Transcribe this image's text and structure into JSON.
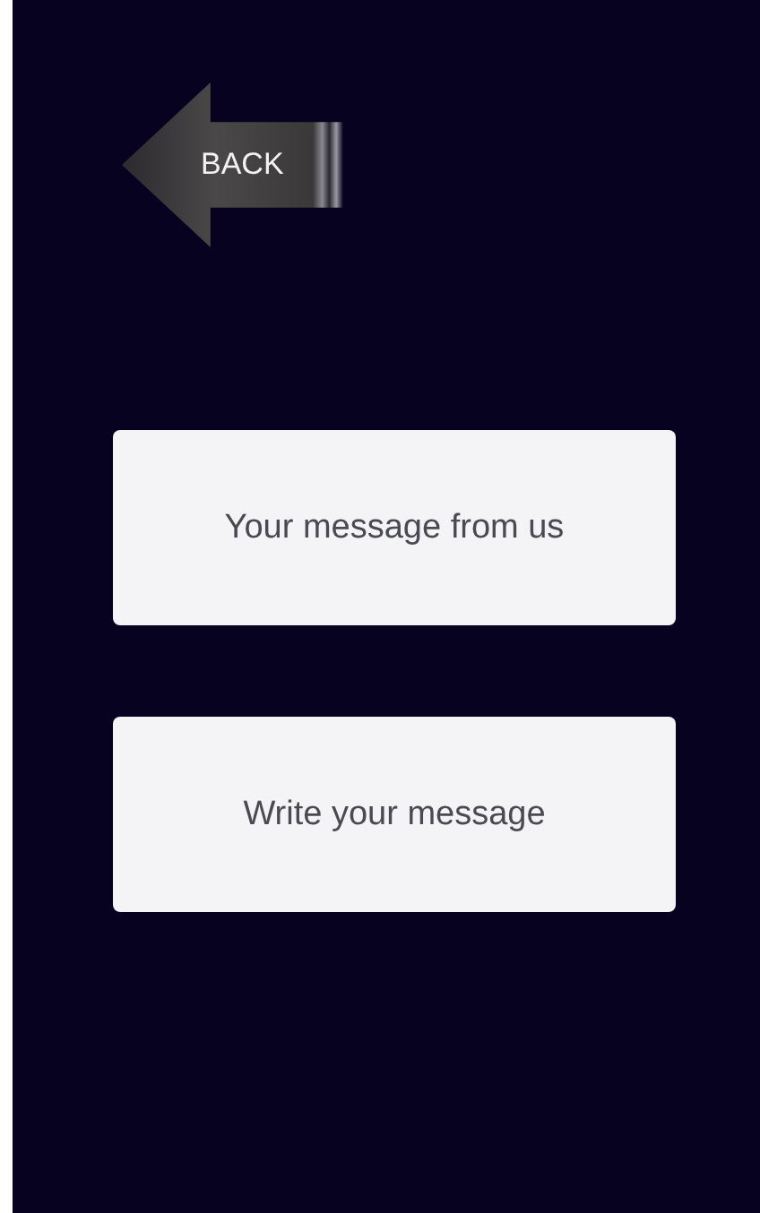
{
  "back_button": {
    "label": "BACK"
  },
  "buttons": [
    {
      "label": "Your message from us"
    },
    {
      "label": "Write your message"
    }
  ]
}
